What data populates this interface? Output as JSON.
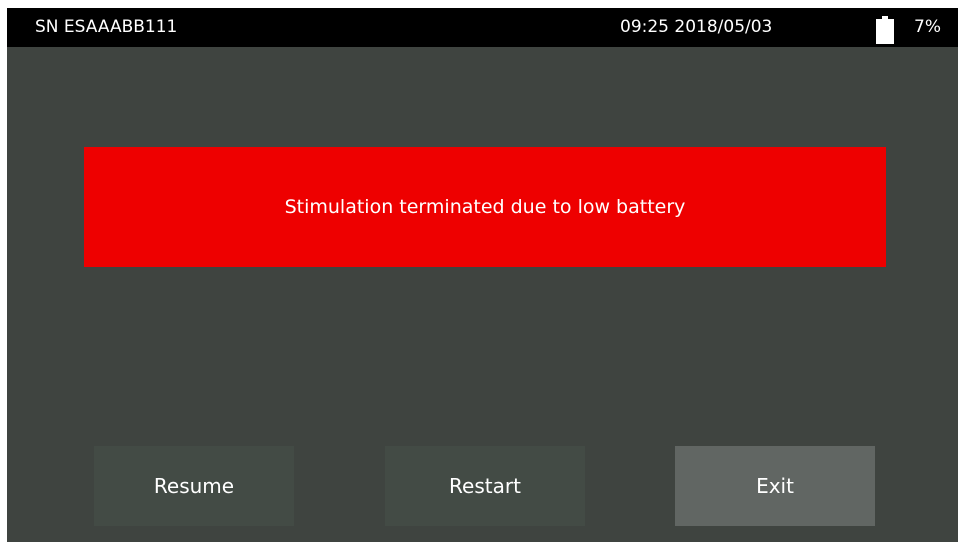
{
  "status_bar": {
    "serial_number": "SN ESAAABB111",
    "datetime": "09:25 2018/05/03",
    "battery_icon": "battery-icon",
    "battery_level": "7%",
    "battery_fraction": 0.07
  },
  "alert": {
    "message": "Stimulation terminated due to low battery",
    "color": "#ee0000"
  },
  "actions": {
    "resume_label": "Resume",
    "restart_label": "Restart",
    "exit_label": "Exit"
  },
  "colors": {
    "background": "#3f4440",
    "status_bar": "#000000",
    "button": "#434b45",
    "button_highlight": "#616663"
  }
}
